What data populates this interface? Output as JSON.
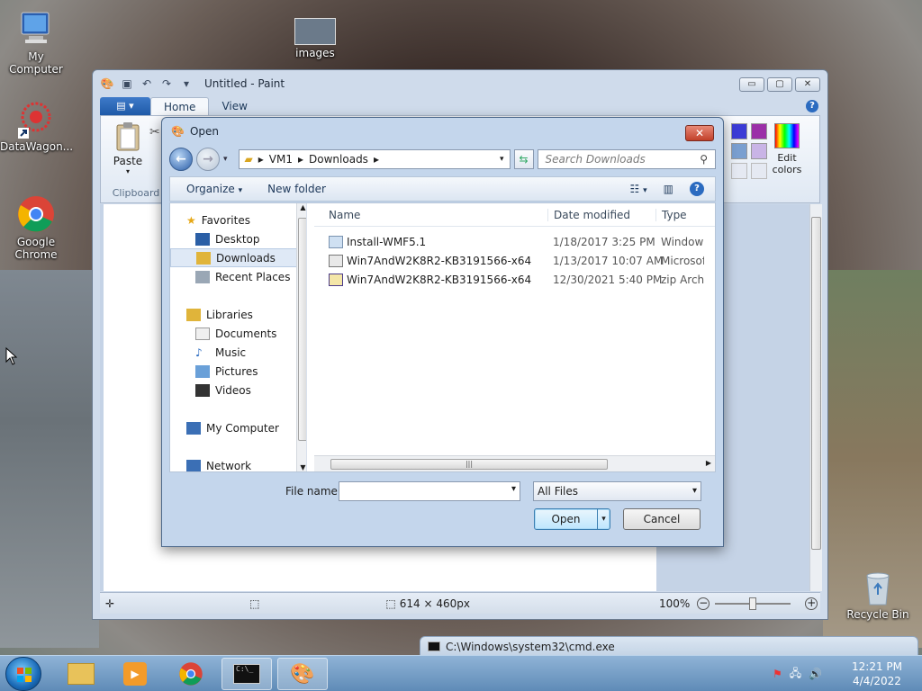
{
  "desktop": {
    "icons": [
      {
        "label": "My Computer"
      },
      {
        "label": "images"
      },
      {
        "label": "DataWagon..."
      },
      {
        "label": "Google Chrome"
      },
      {
        "label": "Recycle Bin"
      }
    ]
  },
  "paint": {
    "title": "Untitled - Paint",
    "tabs": [
      "Home",
      "View"
    ],
    "ribbon": {
      "paste_label": "Paste",
      "clipboard_group": "Clipboard",
      "edit_colors_label": "Edit colors"
    },
    "status": {
      "size": "614 × 460px",
      "zoom": "100%"
    },
    "palette": [
      "#3b3bd6",
      "#9b2fa8",
      "#7a9fd0",
      "#c9b4e6",
      "#e5e9f2",
      "#e5e9f2"
    ]
  },
  "dialog": {
    "title": "Open",
    "address": {
      "path": [
        "VM1",
        "Downloads"
      ]
    },
    "search_placeholder": "Search Downloads",
    "toolbar": {
      "organize": "Organize",
      "new_folder": "New folder"
    },
    "nav": {
      "favorites": "Favorites",
      "favorite_items": [
        "Desktop",
        "Downloads",
        "Recent Places"
      ],
      "libraries": "Libraries",
      "library_items": [
        "Documents",
        "Music",
        "Pictures",
        "Videos"
      ],
      "computer": "My Computer",
      "network": "Network"
    },
    "columns": {
      "name": "Name",
      "date": "Date modified",
      "type": "Type"
    },
    "files": [
      {
        "name": "Install-WMF5.1",
        "date": "1/18/2017 3:25 PM",
        "type": "Windows"
      },
      {
        "name": "Win7AndW2K8R2-KB3191566-x64",
        "date": "1/13/2017 10:07 AM",
        "type": "Microsoft"
      },
      {
        "name": "Win7AndW2K8R2-KB3191566-x64",
        "date": "12/30/2021 5:40 PM",
        "type": "zip Archive"
      }
    ],
    "file_name_label": "File name:",
    "file_name_value": "",
    "filter": "All Files",
    "open_button": "Open",
    "cancel_button": "Cancel"
  },
  "cmd_window": {
    "title": "C:\\Windows\\system32\\cmd.exe"
  },
  "clock": {
    "time": "12:21 PM",
    "date": "4/4/2022"
  }
}
